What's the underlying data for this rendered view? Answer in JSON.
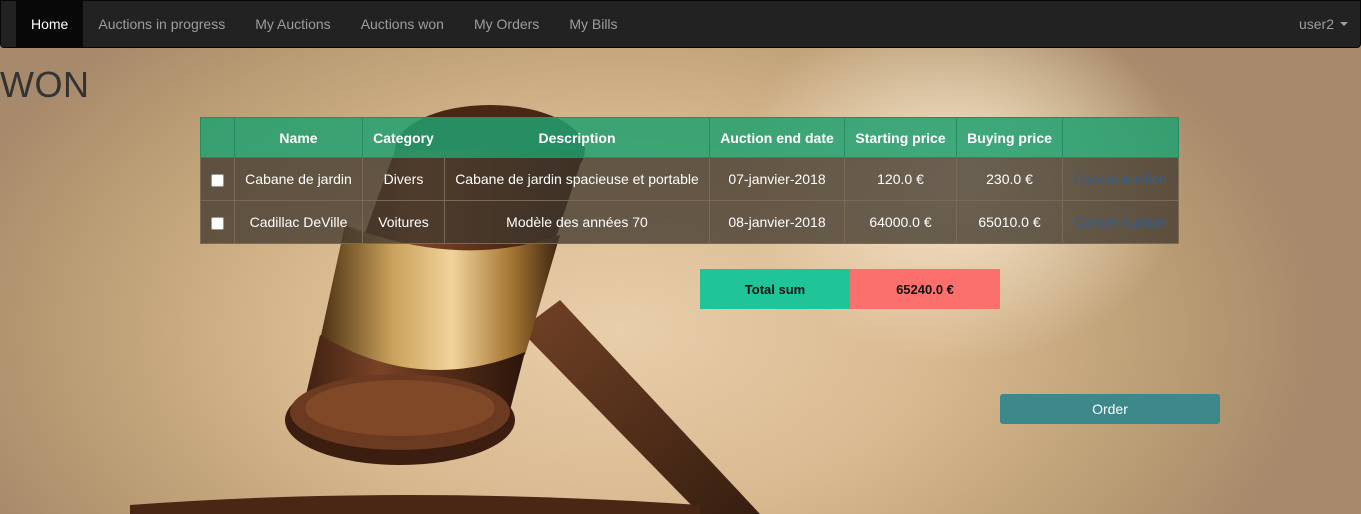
{
  "nav": {
    "items": [
      {
        "label": "Home",
        "active": true
      },
      {
        "label": "Auctions in progress",
        "active": false
      },
      {
        "label": "My Auctions",
        "active": false
      },
      {
        "label": "Auctions won",
        "active": false
      },
      {
        "label": "My Orders",
        "active": false
      },
      {
        "label": "My Bills",
        "active": false
      }
    ],
    "user": "user2"
  },
  "page": {
    "title": "WON"
  },
  "table": {
    "headers": [
      "",
      "Name",
      "Category",
      "Description",
      "Auction end date",
      "Starting price",
      "Buying price",
      ""
    ],
    "rows": [
      {
        "checked": false,
        "name": "Cabane de jardin",
        "category": "Divers",
        "description": "Cabane de jardin spacieuse et portable",
        "end_date": "07-janvier-2018",
        "starting_price": "120.0 €",
        "buying_price": "230.0 €",
        "action": "Cancel Auction"
      },
      {
        "checked": false,
        "name": "Cadillac DeVille",
        "category": "Voitures",
        "description": "Modèle des années 70",
        "end_date": "08-janvier-2018",
        "starting_price": "64000.0 €",
        "buying_price": "65010.0 €",
        "action": "Cancel Auction"
      }
    ]
  },
  "total": {
    "label": "Total sum",
    "value": "65240.0 €"
  },
  "order_button": "Order",
  "colors": {
    "navbar": "#222222",
    "table_header": "#21a070",
    "total_label_bg": "#1fc598",
    "total_value_bg": "#fb706c",
    "order_button": "#3c888a",
    "link": "#2f5f96"
  },
  "background_image": "gavel"
}
